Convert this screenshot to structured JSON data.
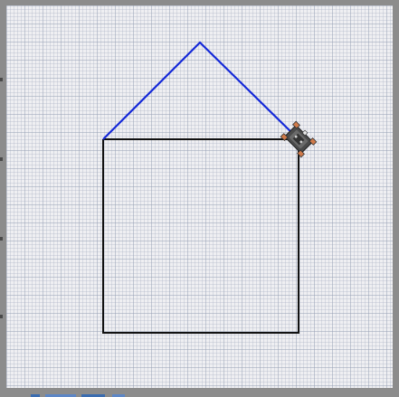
{
  "scene": {
    "description_colors": {
      "background": "#efeff2",
      "frame": "#8c8c8c",
      "house_body_stroke": "#111111",
      "roof_stroke": "#1428d8",
      "turtle_body": "#4b4b4b",
      "turtle_accent": "#d07a4a"
    },
    "drawing": {
      "shape": "house",
      "body": "square",
      "roof": "triangle"
    },
    "sprite": {
      "icon": "robot-turtle-icon",
      "heading_deg": 45
    }
  }
}
